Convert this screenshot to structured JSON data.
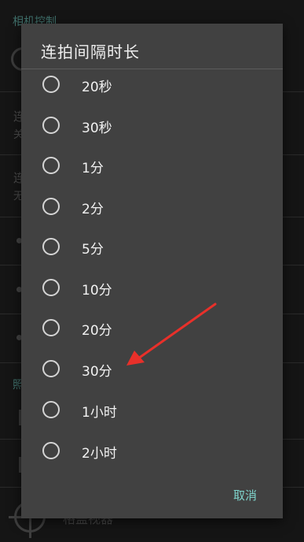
{
  "background": {
    "section_camera": "相机控制",
    "item1_title": "连",
    "item1_sub": "关",
    "item2_title": "连",
    "item2_sub": "无",
    "section_photo": "照",
    "bottom_text": "格盖视器"
  },
  "dialog": {
    "title": "连拍间隔时长",
    "options": [
      {
        "label": "20秒"
      },
      {
        "label": "30秒"
      },
      {
        "label": "1分"
      },
      {
        "label": "2分"
      },
      {
        "label": "5分"
      },
      {
        "label": "10分"
      },
      {
        "label": "20分"
      },
      {
        "label": "30分"
      },
      {
        "label": "1小时"
      },
      {
        "label": "2小时"
      }
    ],
    "cancel_label": "取消"
  },
  "colors": {
    "dialog_bg": "#414141",
    "accent": "#7ed3cb",
    "arrow": "#e8302a"
  }
}
